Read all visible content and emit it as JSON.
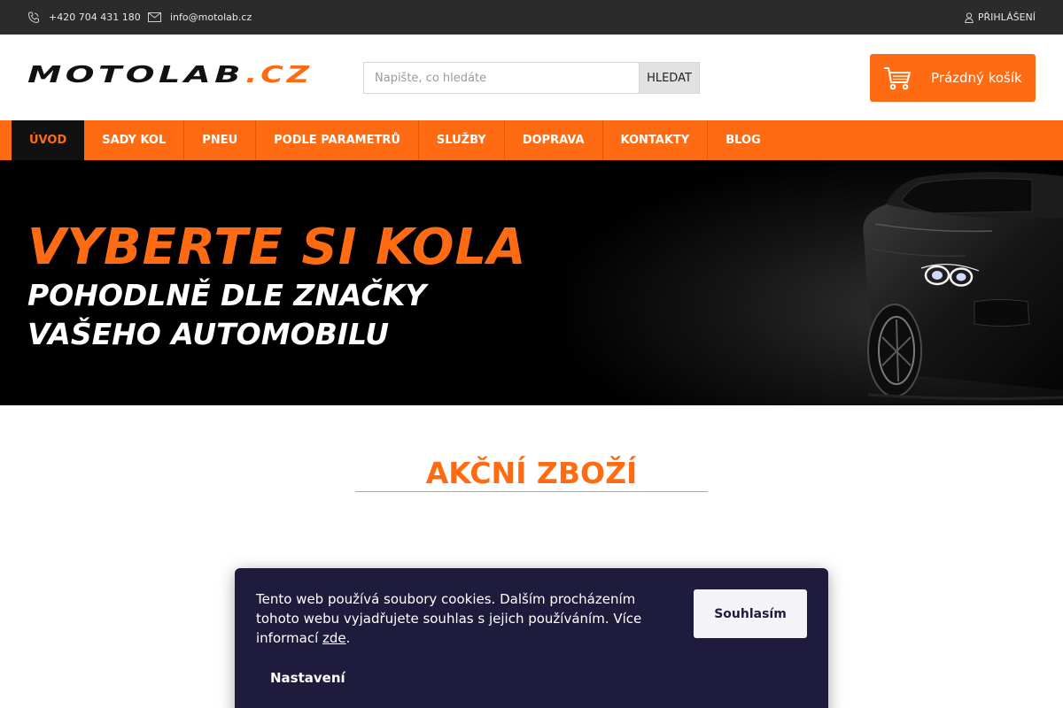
{
  "topbar": {
    "phone": "+420 704 431 180",
    "email": "info@motolab.cz",
    "login": "PŘIHLÁŠENÍ"
  },
  "header": {
    "logo_text": "MOTOLAB.CZ",
    "search": {
      "placeholder": "Napište, co hledáte",
      "button_label": "HLEDAT"
    },
    "cart_label": "Prázdný košík"
  },
  "nav": {
    "items": [
      {
        "label": "ÚVOD",
        "active": true
      },
      {
        "label": "SADY KOL"
      },
      {
        "label": "PNEU"
      },
      {
        "label": "PODLE PARAMETRŮ"
      },
      {
        "label": "SLUŽBY"
      },
      {
        "label": "DOPRAVA"
      },
      {
        "label": "KONTAKTY"
      },
      {
        "label": "BLOG"
      }
    ]
  },
  "banner": {
    "headline": "VYBERTE SI KOLA",
    "line1": "POHODLNĚ DLE ZNAČKY",
    "line2": "VAŠEHO AUTOMOBILU"
  },
  "section": {
    "title": "AKČNÍ ZBOŽÍ"
  },
  "cookie": {
    "text": "Tento web používá soubory cookies. Dalším procházením tohoto webu vyjadřujete souhlas s jejich používáním. Více informací ",
    "link": "zde",
    "trail": ".",
    "agree_label": "Souhlasím",
    "settings_label": "Nastavení"
  },
  "colors": {
    "accent": "#ff6b12",
    "topbar": "#2b2b2b",
    "cookie_bg": "#1e1b3d"
  }
}
